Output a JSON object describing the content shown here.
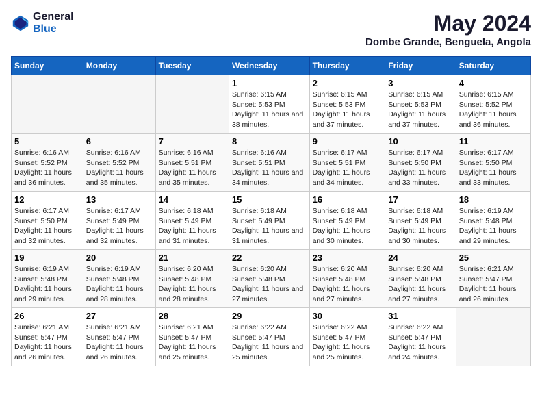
{
  "header": {
    "logo_general": "General",
    "logo_blue": "Blue",
    "title": "May 2024",
    "subtitle": "Dombe Grande, Benguela, Angola"
  },
  "calendar": {
    "weekdays": [
      "Sunday",
      "Monday",
      "Tuesday",
      "Wednesday",
      "Thursday",
      "Friday",
      "Saturday"
    ],
    "weeks": [
      [
        {
          "day": "",
          "sunrise": "",
          "sunset": "",
          "daylight": ""
        },
        {
          "day": "",
          "sunrise": "",
          "sunset": "",
          "daylight": ""
        },
        {
          "day": "",
          "sunrise": "",
          "sunset": "",
          "daylight": ""
        },
        {
          "day": "1",
          "sunrise": "Sunrise: 6:15 AM",
          "sunset": "Sunset: 5:53 PM",
          "daylight": "Daylight: 11 hours and 38 minutes."
        },
        {
          "day": "2",
          "sunrise": "Sunrise: 6:15 AM",
          "sunset": "Sunset: 5:53 PM",
          "daylight": "Daylight: 11 hours and 37 minutes."
        },
        {
          "day": "3",
          "sunrise": "Sunrise: 6:15 AM",
          "sunset": "Sunset: 5:53 PM",
          "daylight": "Daylight: 11 hours and 37 minutes."
        },
        {
          "day": "4",
          "sunrise": "Sunrise: 6:15 AM",
          "sunset": "Sunset: 5:52 PM",
          "daylight": "Daylight: 11 hours and 36 minutes."
        }
      ],
      [
        {
          "day": "5",
          "sunrise": "Sunrise: 6:16 AM",
          "sunset": "Sunset: 5:52 PM",
          "daylight": "Daylight: 11 hours and 36 minutes."
        },
        {
          "day": "6",
          "sunrise": "Sunrise: 6:16 AM",
          "sunset": "Sunset: 5:52 PM",
          "daylight": "Daylight: 11 hours and 35 minutes."
        },
        {
          "day": "7",
          "sunrise": "Sunrise: 6:16 AM",
          "sunset": "Sunset: 5:51 PM",
          "daylight": "Daylight: 11 hours and 35 minutes."
        },
        {
          "day": "8",
          "sunrise": "Sunrise: 6:16 AM",
          "sunset": "Sunset: 5:51 PM",
          "daylight": "Daylight: 11 hours and 34 minutes."
        },
        {
          "day": "9",
          "sunrise": "Sunrise: 6:17 AM",
          "sunset": "Sunset: 5:51 PM",
          "daylight": "Daylight: 11 hours and 34 minutes."
        },
        {
          "day": "10",
          "sunrise": "Sunrise: 6:17 AM",
          "sunset": "Sunset: 5:50 PM",
          "daylight": "Daylight: 11 hours and 33 minutes."
        },
        {
          "day": "11",
          "sunrise": "Sunrise: 6:17 AM",
          "sunset": "Sunset: 5:50 PM",
          "daylight": "Daylight: 11 hours and 33 minutes."
        }
      ],
      [
        {
          "day": "12",
          "sunrise": "Sunrise: 6:17 AM",
          "sunset": "Sunset: 5:50 PM",
          "daylight": "Daylight: 11 hours and 32 minutes."
        },
        {
          "day": "13",
          "sunrise": "Sunrise: 6:17 AM",
          "sunset": "Sunset: 5:49 PM",
          "daylight": "Daylight: 11 hours and 32 minutes."
        },
        {
          "day": "14",
          "sunrise": "Sunrise: 6:18 AM",
          "sunset": "Sunset: 5:49 PM",
          "daylight": "Daylight: 11 hours and 31 minutes."
        },
        {
          "day": "15",
          "sunrise": "Sunrise: 6:18 AM",
          "sunset": "Sunset: 5:49 PM",
          "daylight": "Daylight: 11 hours and 31 minutes."
        },
        {
          "day": "16",
          "sunrise": "Sunrise: 6:18 AM",
          "sunset": "Sunset: 5:49 PM",
          "daylight": "Daylight: 11 hours and 30 minutes."
        },
        {
          "day": "17",
          "sunrise": "Sunrise: 6:18 AM",
          "sunset": "Sunset: 5:49 PM",
          "daylight": "Daylight: 11 hours and 30 minutes."
        },
        {
          "day": "18",
          "sunrise": "Sunrise: 6:19 AM",
          "sunset": "Sunset: 5:48 PM",
          "daylight": "Daylight: 11 hours and 29 minutes."
        }
      ],
      [
        {
          "day": "19",
          "sunrise": "Sunrise: 6:19 AM",
          "sunset": "Sunset: 5:48 PM",
          "daylight": "Daylight: 11 hours and 29 minutes."
        },
        {
          "day": "20",
          "sunrise": "Sunrise: 6:19 AM",
          "sunset": "Sunset: 5:48 PM",
          "daylight": "Daylight: 11 hours and 28 minutes."
        },
        {
          "day": "21",
          "sunrise": "Sunrise: 6:20 AM",
          "sunset": "Sunset: 5:48 PM",
          "daylight": "Daylight: 11 hours and 28 minutes."
        },
        {
          "day": "22",
          "sunrise": "Sunrise: 6:20 AM",
          "sunset": "Sunset: 5:48 PM",
          "daylight": "Daylight: 11 hours and 27 minutes."
        },
        {
          "day": "23",
          "sunrise": "Sunrise: 6:20 AM",
          "sunset": "Sunset: 5:48 PM",
          "daylight": "Daylight: 11 hours and 27 minutes."
        },
        {
          "day": "24",
          "sunrise": "Sunrise: 6:20 AM",
          "sunset": "Sunset: 5:48 PM",
          "daylight": "Daylight: 11 hours and 27 minutes."
        },
        {
          "day": "25",
          "sunrise": "Sunrise: 6:21 AM",
          "sunset": "Sunset: 5:47 PM",
          "daylight": "Daylight: 11 hours and 26 minutes."
        }
      ],
      [
        {
          "day": "26",
          "sunrise": "Sunrise: 6:21 AM",
          "sunset": "Sunset: 5:47 PM",
          "daylight": "Daylight: 11 hours and 26 minutes."
        },
        {
          "day": "27",
          "sunrise": "Sunrise: 6:21 AM",
          "sunset": "Sunset: 5:47 PM",
          "daylight": "Daylight: 11 hours and 26 minutes."
        },
        {
          "day": "28",
          "sunrise": "Sunrise: 6:21 AM",
          "sunset": "Sunset: 5:47 PM",
          "daylight": "Daylight: 11 hours and 25 minutes."
        },
        {
          "day": "29",
          "sunrise": "Sunrise: 6:22 AM",
          "sunset": "Sunset: 5:47 PM",
          "daylight": "Daylight: 11 hours and 25 minutes."
        },
        {
          "day": "30",
          "sunrise": "Sunrise: 6:22 AM",
          "sunset": "Sunset: 5:47 PM",
          "daylight": "Daylight: 11 hours and 25 minutes."
        },
        {
          "day": "31",
          "sunrise": "Sunrise: 6:22 AM",
          "sunset": "Sunset: 5:47 PM",
          "daylight": "Daylight: 11 hours and 24 minutes."
        },
        {
          "day": "",
          "sunrise": "",
          "sunset": "",
          "daylight": ""
        }
      ]
    ]
  }
}
